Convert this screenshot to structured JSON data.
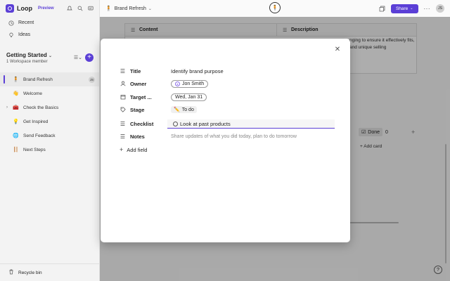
{
  "app": {
    "name": "Loop",
    "badge": "Preview"
  },
  "sidebar": {
    "nav": [
      {
        "label": "Recent",
        "icon": "clock-icon"
      },
      {
        "label": "Ideas",
        "icon": "lightbulb-icon"
      }
    ],
    "workspace": {
      "title": "Getting Started",
      "subtitle": "1 Workspace member"
    },
    "pages": [
      {
        "label": "Brand Refresh",
        "icon": "🧍",
        "active": true,
        "badge": "JS"
      },
      {
        "label": "Welcome",
        "icon": "👋"
      },
      {
        "label": "Check the Basics",
        "icon": "🧰",
        "expandable": true
      },
      {
        "label": "Get Inspired",
        "icon": "💡"
      },
      {
        "label": "Send Feedback",
        "icon": "🌐"
      },
      {
        "label": "Next Steps",
        "icon": "🪜"
      }
    ],
    "recycle_bin": "Recycle bin"
  },
  "topbar": {
    "breadcrumb": "Brand Refresh",
    "share_label": "Share",
    "user_initials": "JS"
  },
  "background": {
    "table_headers": [
      "Content",
      "Description"
    ],
    "description_text": "nging to ensure it effectively fits, and unique selling",
    "done_label": "Done",
    "done_count": "0",
    "add_card": "Add card"
  },
  "modal": {
    "fields": {
      "title": {
        "label": "Title",
        "value": "Identify brand purpose"
      },
      "owner": {
        "label": "Owner",
        "value": "Jon Smith"
      },
      "target": {
        "label": "Target ...",
        "value": "Wed, Jan 31"
      },
      "stage": {
        "label": "Stage",
        "value": "To do",
        "emoji": "✏️"
      },
      "checklist": {
        "label": "Checklist",
        "value": "Look at past products"
      },
      "notes": {
        "label": "Notes",
        "placeholder": "Share updates of what you did today, plan to do tomorrow"
      }
    },
    "add_field": "Add field"
  },
  "colors": {
    "accent": "#5b3fd6"
  }
}
